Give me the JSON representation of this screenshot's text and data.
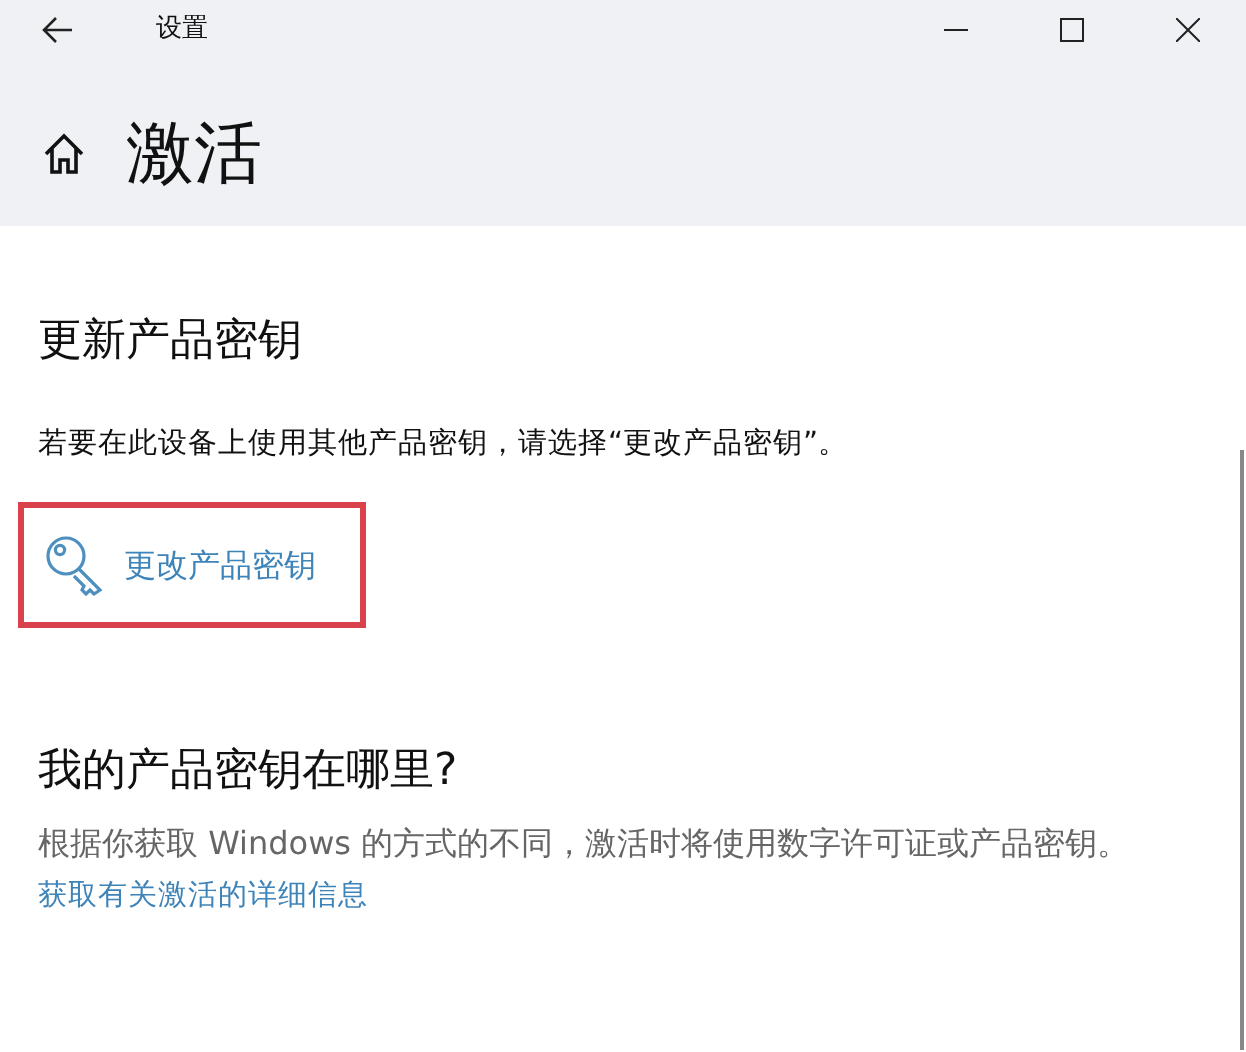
{
  "window": {
    "title": "设置"
  },
  "page": {
    "title": "激活"
  },
  "sections": [
    {
      "heading": "更新产品密钥",
      "text": "若要在此设备上使用其他产品密钥，请选择“更改产品密钥”。",
      "action": {
        "label": "更改产品密钥",
        "highlighted": true
      }
    },
    {
      "heading": "我的产品密钥在哪里?",
      "text": "根据你获取 Windows 的方式的不同，激活时将使用数字许可证或产品密钥。",
      "link": "获取有关激活的详细信息"
    }
  ]
}
